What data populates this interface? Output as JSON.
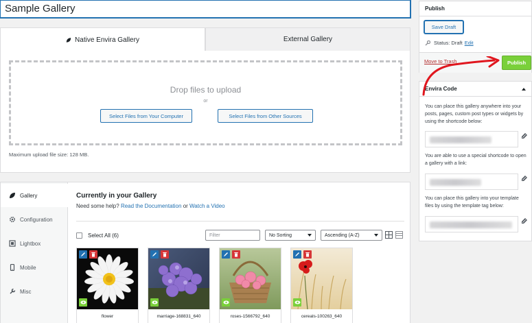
{
  "post_title": "Sample Gallery",
  "tabs": [
    {
      "label": "Native Envira Gallery"
    },
    {
      "label": "External Gallery"
    }
  ],
  "uploader": {
    "drop_text": "Drop files to upload",
    "or_text": "or",
    "select_computer": "Select Files from Your Computer",
    "select_sources": "Select Files from Other Sources",
    "max_size": "Maximum upload file size: 128 MB."
  },
  "side_tabs": [
    {
      "label": "Gallery",
      "icon": "leaf-icon"
    },
    {
      "label": "Configuration",
      "icon": "gear-icon"
    },
    {
      "label": "Lightbox",
      "icon": "lightbox-icon"
    },
    {
      "label": "Mobile",
      "icon": "mobile-icon"
    },
    {
      "label": "Misc",
      "icon": "wrench-icon"
    }
  ],
  "gallery": {
    "heading": "Currently in your Gallery",
    "help_prefix": "Need some help?",
    "doc_link": "Read the Documentation",
    "help_or": "or",
    "video_link": "Watch a Video",
    "select_all": "Select All (6)",
    "filter_placeholder": "Filter",
    "sort_value": "No Sorting",
    "order_value": "Ascending (A-Z)",
    "items": [
      {
        "label": "flower"
      },
      {
        "label": "marriage-168831_640"
      },
      {
        "label": "roses-1566792_640"
      },
      {
        "label": "cereals-100263_640"
      }
    ]
  },
  "publish": {
    "title": "Publish",
    "save_draft": "Save Draft",
    "status_label": "Status: Draft",
    "status_edit": "Edit",
    "move_trash": "Move to Trash",
    "publish_button": "Publish"
  },
  "envira_code": {
    "title": "Envira Code",
    "text1": "You can place this gallery anywhere into your posts, pages, custom post types or widgets by using the shortcode below:",
    "text2": "You are able to use a special shortcode to open a gallery with a link:",
    "text3": "You can place this gallery into your template files by using the template tag below:"
  },
  "colors": {
    "accent": "#2271b1",
    "publish_green": "#7ad03a",
    "delete_red": "#d63638",
    "annotation_arrow": "#e0161e"
  }
}
